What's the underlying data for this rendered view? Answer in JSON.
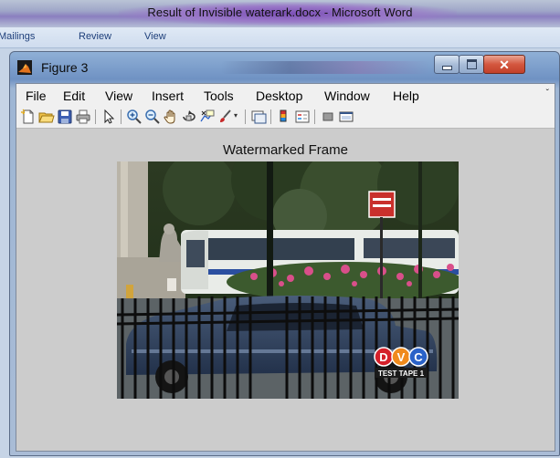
{
  "word_window": {
    "title": "Result of Invisible waterark.docx - Microsoft Word",
    "ribbon_tabs": [
      "Mailings",
      "Review",
      "View"
    ]
  },
  "figure_window": {
    "title": "Figure 3",
    "menu": [
      "File",
      "Edit",
      "View",
      "Insert",
      "Tools",
      "Desktop",
      "Window",
      "Help"
    ],
    "menu_overflow": "ˇ",
    "close_glyph": "✕",
    "toolbar_icons": [
      "new-figure-icon",
      "open-file-icon",
      "save-icon",
      "print-icon",
      "edit-plot-arrow-icon",
      "zoom-in-icon",
      "zoom-out-icon",
      "pan-hand-icon",
      "rotate-3d-icon",
      "data-cursor-icon",
      "brush-icon",
      "link-plot-icon",
      "colorbar-icon",
      "legend-icon",
      "hide-plot-tools-icon",
      "show-plot-tools-icon"
    ],
    "plot_title": "Watermarked Frame",
    "image_watermark": {
      "letters": [
        "D",
        "V",
        "C"
      ],
      "caption": "TEST TAPE 1"
    }
  },
  "colors": {
    "word_titlebar_accent": "#7b4fb6",
    "figure_background": "#cccccc",
    "dvc_red": "#d5202a",
    "dvc_orange": "#f08a1c",
    "dvc_blue": "#2a62c8"
  }
}
